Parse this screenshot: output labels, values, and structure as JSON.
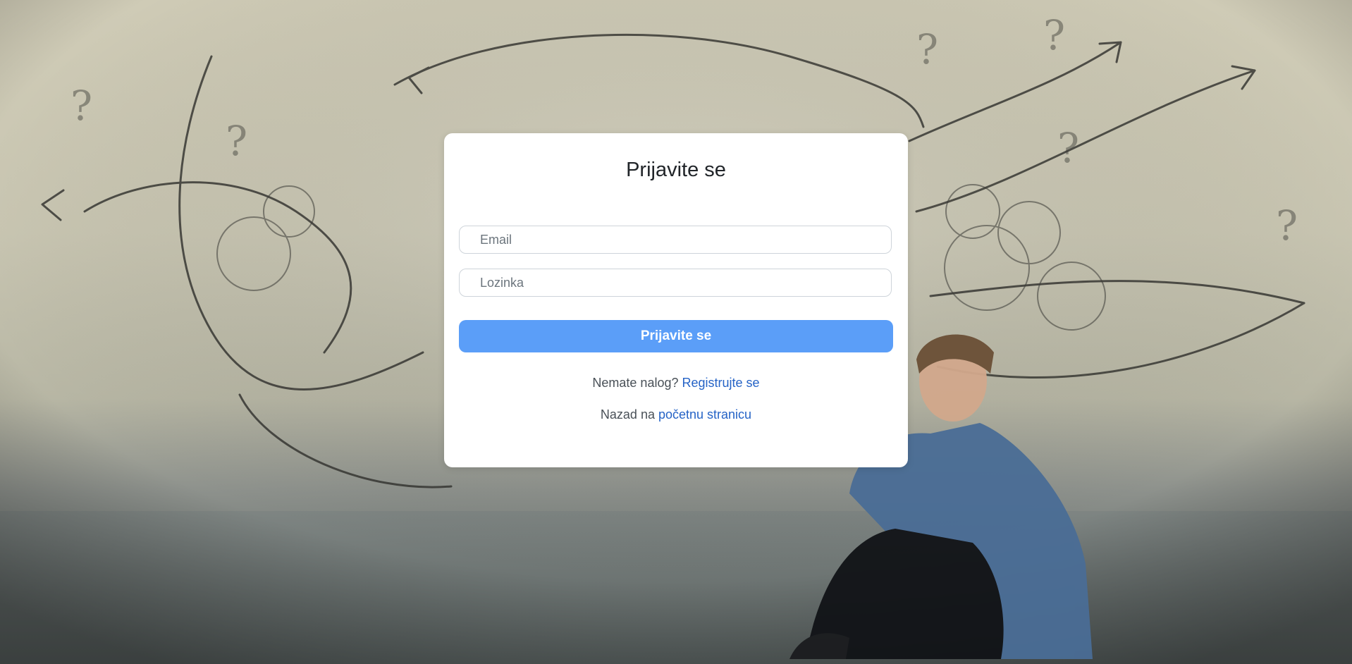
{
  "login": {
    "title": "Prijavite se",
    "email_placeholder": "Email",
    "password_placeholder": "Lozinka",
    "submit_label": "Prijavite se",
    "register_prompt": "Nemate nalog?",
    "register_link": "Registrujte se",
    "home_prompt": "Nazad na",
    "home_link": "početnu stranicu"
  },
  "colors": {
    "button": "#5b9ef8",
    "link": "#2563c6",
    "card": "#ffffff"
  }
}
